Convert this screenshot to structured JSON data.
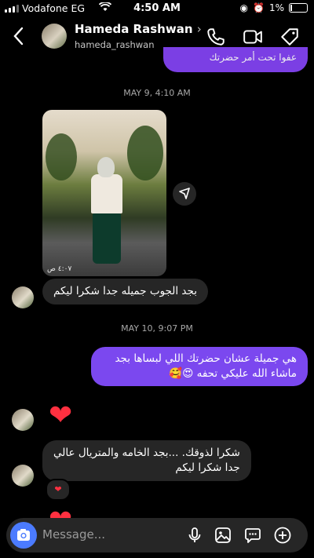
{
  "status_bar": {
    "carrier": "Vodafone EG",
    "time": "4:50 AM",
    "battery": "1%"
  },
  "header": {
    "name": "Hameda Rashwan",
    "username": "hameda_rashwan"
  },
  "messages": {
    "prev_sent_snippet": "عفوا تحت أمر حضرتك",
    "timestamp_1": "MAY 9, 4:10 AM",
    "photo_stamp": "٤:٠٧ ص",
    "received_1": "بجد الجوب جميله جدا شكرا ليكم",
    "timestamp_2": "MAY 10, 9:07 PM",
    "sent_1_line1": "هي جميلة عشان حضرتك اللي لبساها بجد",
    "sent_1_line2": "ماشاء الله عليكي  تحفه 😍🥰",
    "heart_1": "❤",
    "received_2_line1": "شكرا لذوقك. ...بجد الخامه والمتريال عالي",
    "received_2_line2": "جدا شكرا ليكم",
    "reaction": "❤",
    "heart_2": "❤"
  },
  "composer": {
    "placeholder": "Message..."
  },
  "colors": {
    "sent_bubble": "#7b48ef",
    "received_bubble": "#262626",
    "camera_button": "#4b7bff",
    "heart": "#ff3040"
  },
  "icons": [
    "back-chevron-icon",
    "phone-icon",
    "video-camera-icon",
    "tag-icon",
    "share-icon",
    "camera-icon",
    "microphone-icon",
    "gallery-icon",
    "sticker-icon",
    "add-icon"
  ]
}
